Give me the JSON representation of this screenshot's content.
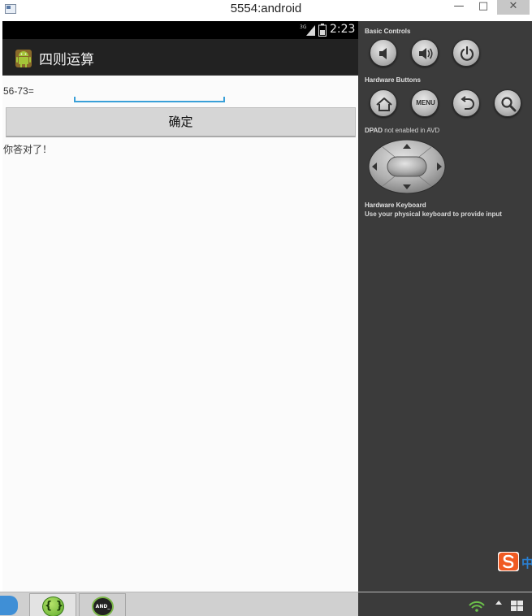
{
  "window": {
    "title": "5554:android",
    "minimize_glyph": "—",
    "maximize_glyph": "□",
    "close_glyph": "✕"
  },
  "status_bar": {
    "network": "3G",
    "time": "2:23"
  },
  "app": {
    "name": "四则运算",
    "question": "56-73=",
    "answer_value": "",
    "confirm_label": "确定",
    "result": "你答对了！"
  },
  "controls": {
    "basic_controls_label": "Basic Controls",
    "hardware_buttons_label": "Hardware Buttons",
    "menu_label": "MENU",
    "dpad_label_bold": "DPAD",
    "dpad_label_rest": " not enabled in AVD",
    "keyboard_label": "Hardware Keyboard",
    "keyboard_note": "Use your physical keyboard to provide input"
  },
  "ime": {
    "cn_char": "中"
  },
  "taskbar": {
    "json_glyph": "{ }",
    "adb_glyph": "AND_"
  },
  "colors": {
    "input_underline": "#3aa0d8",
    "panel_bg": "#3b3b3b",
    "action_bar": "#222222"
  }
}
